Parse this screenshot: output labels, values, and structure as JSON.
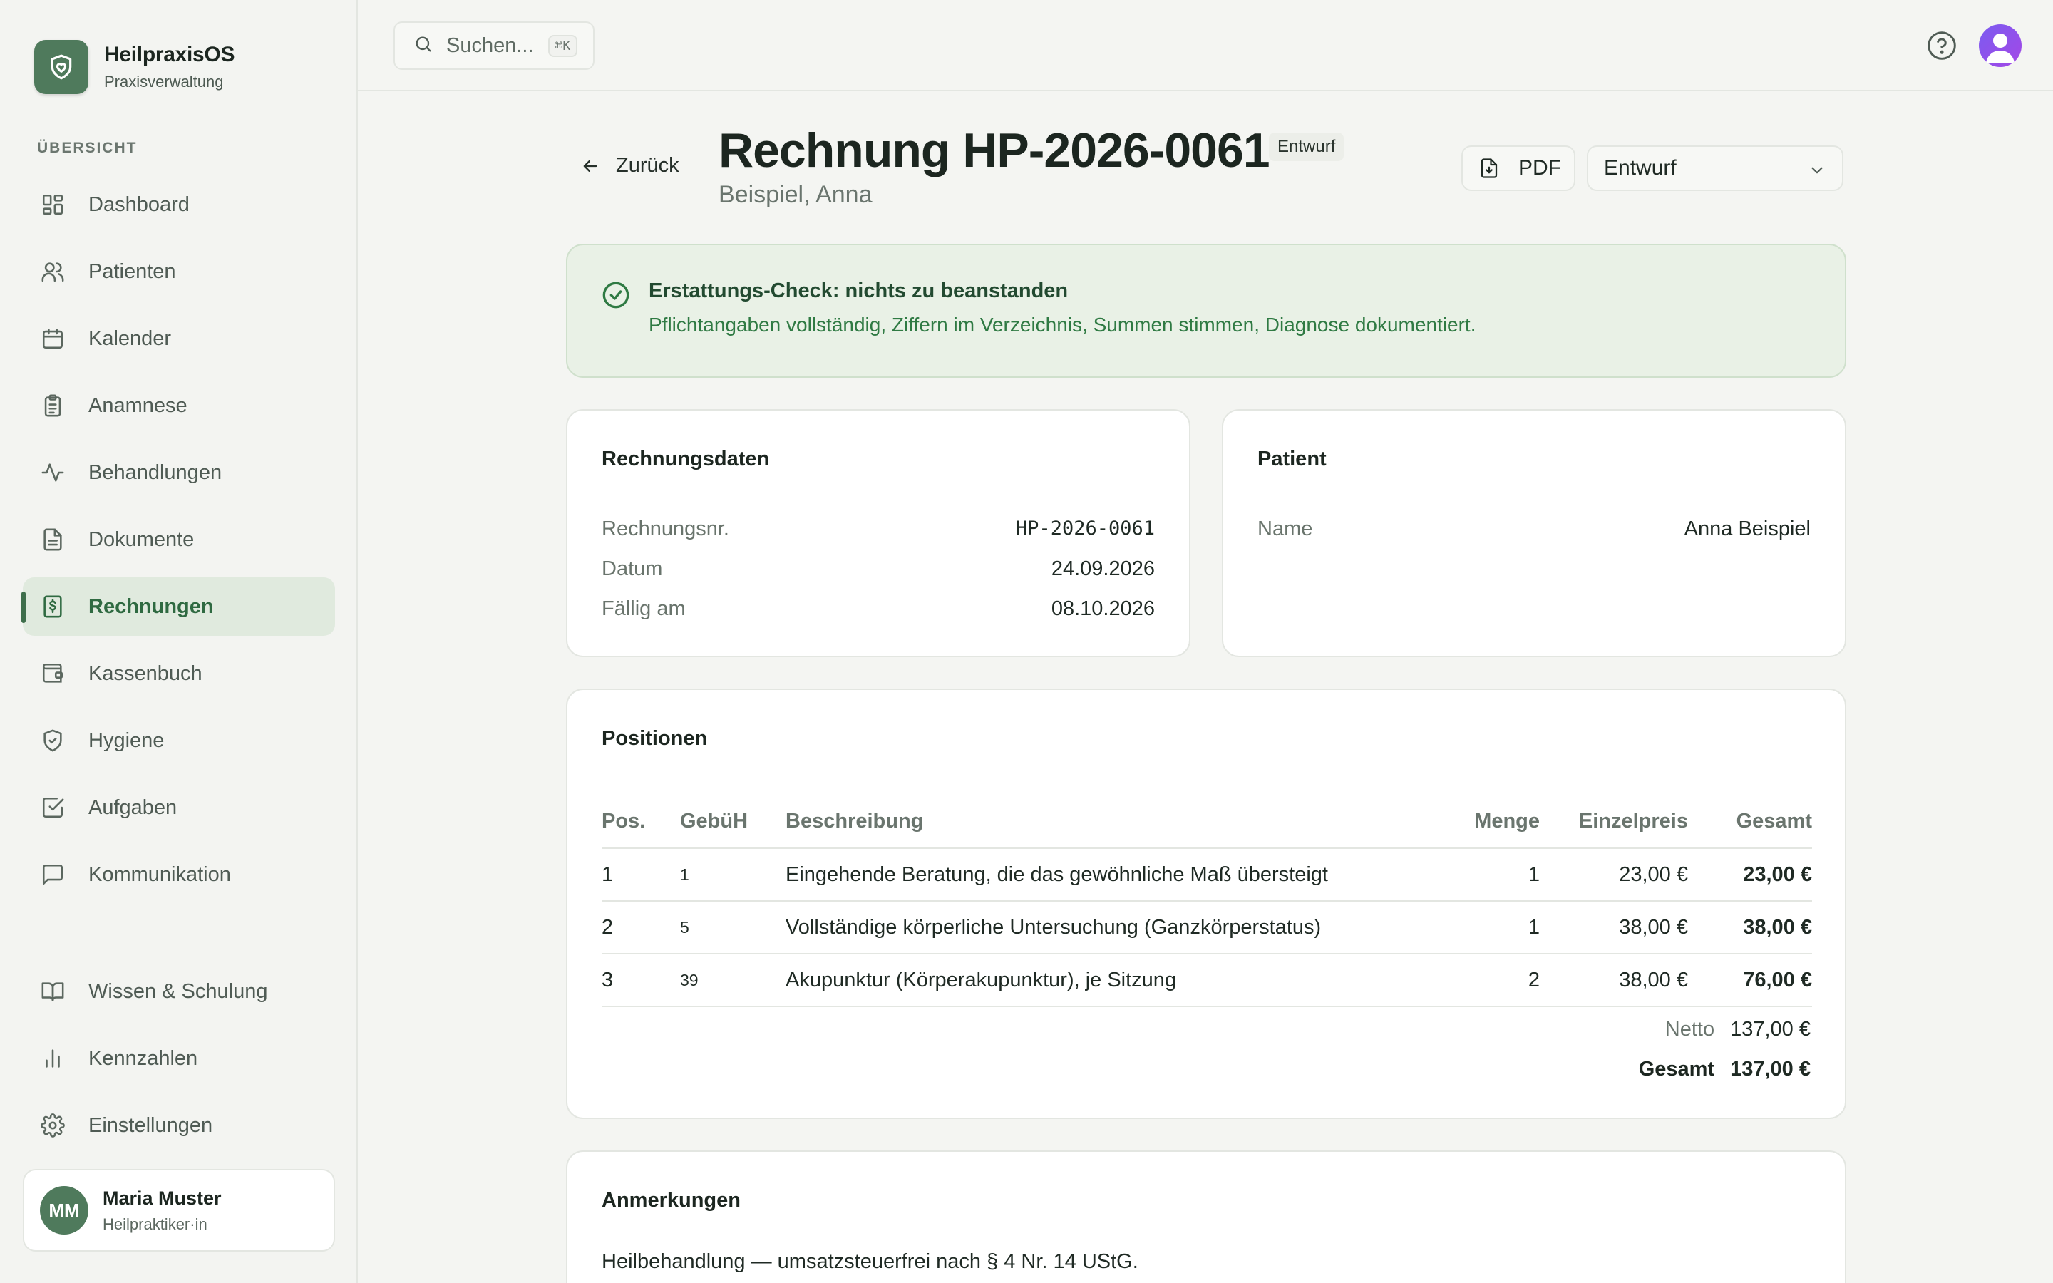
{
  "brand": {
    "name": "HeilpraxisOS",
    "subtitle": "Praxisverwaltung"
  },
  "sidebar": {
    "section_label": "ÜBERSICHT",
    "items": [
      {
        "label": "Dashboard",
        "icon": "dashboard-icon"
      },
      {
        "label": "Patienten",
        "icon": "users-icon"
      },
      {
        "label": "Kalender",
        "icon": "calendar-icon"
      },
      {
        "label": "Anamnese",
        "icon": "clipboard-icon"
      },
      {
        "label": "Behandlungen",
        "icon": "activity-icon"
      },
      {
        "label": "Dokumente",
        "icon": "document-icon"
      },
      {
        "label": "Rechnungen",
        "icon": "invoice-icon",
        "active": true
      },
      {
        "label": "Kassenbuch",
        "icon": "wallet-icon"
      },
      {
        "label": "Hygiene",
        "icon": "shield-icon"
      },
      {
        "label": "Aufgaben",
        "icon": "checkbox-icon"
      },
      {
        "label": "Kommunikation",
        "icon": "message-icon"
      }
    ],
    "bottom_items": [
      {
        "label": "Wissen & Schulung",
        "icon": "book-icon"
      },
      {
        "label": "Kennzahlen",
        "icon": "bar-chart-icon"
      },
      {
        "label": "Einstellungen",
        "icon": "gear-icon"
      }
    ],
    "user": {
      "initials": "MM",
      "name": "Maria Muster",
      "role": "Heilpraktiker·in"
    }
  },
  "topbar": {
    "search_placeholder": "Suchen...",
    "shortcut": "⌘K"
  },
  "header": {
    "back_label": "Zurück",
    "title": "Rechnung HP-2026-0061",
    "badge": "Entwurf",
    "subtitle": "Beispiel, Anna",
    "pdf_label": "PDF",
    "status_value": "Entwurf"
  },
  "alert": {
    "title": "Erstattungs-Check: nichts zu beanstanden",
    "text": "Pflichtangaben vollständig, Ziffern im Verzeichnis, Summen stimmen, Diagnose dokumentiert."
  },
  "invoice_data": {
    "title": "Rechnungsdaten",
    "rows": [
      {
        "label": "Rechnungsnr.",
        "value": "HP-2026-0061"
      },
      {
        "label": "Datum",
        "value": "24.09.2026"
      },
      {
        "label": "Fällig am",
        "value": "08.10.2026"
      }
    ]
  },
  "patient": {
    "title": "Patient",
    "label": "Name",
    "value": "Anna Beispiel"
  },
  "positions": {
    "title": "Positionen",
    "columns": [
      "Pos.",
      "GebüH",
      "Beschreibung",
      "Menge",
      "Einzelpreis",
      "Gesamt"
    ],
    "rows": [
      {
        "pos": "1",
        "code": "1",
        "desc": "Eingehende Beratung, die das gewöhnliche Maß übersteigt",
        "qty": "1",
        "unit": "23,00 €",
        "total": "23,00 €"
      },
      {
        "pos": "2",
        "code": "5",
        "desc": "Vollständige körperliche Untersuchung (Ganzkörperstatus)",
        "qty": "1",
        "unit": "38,00 €",
        "total": "38,00 €"
      },
      {
        "pos": "3",
        "code": "39",
        "desc": "Akupunktur (Körperakupunktur), je Sitzung",
        "qty": "2",
        "unit": "38,00 €",
        "total": "76,00 €"
      }
    ],
    "netto_label": "Netto",
    "netto_value": "137,00 €",
    "gesamt_label": "Gesamt",
    "gesamt_value": "137,00 €"
  },
  "notes": {
    "title": "Anmerkungen",
    "text": "Heilbehandlung — umsatzsteuerfrei nach § 4 Nr. 14 UStG."
  },
  "colors": {
    "accent": "#4f7a5c",
    "active_bg": "#e0eade",
    "alert_bg": "#e9f1e6",
    "alert_text": "#2f7a43"
  }
}
